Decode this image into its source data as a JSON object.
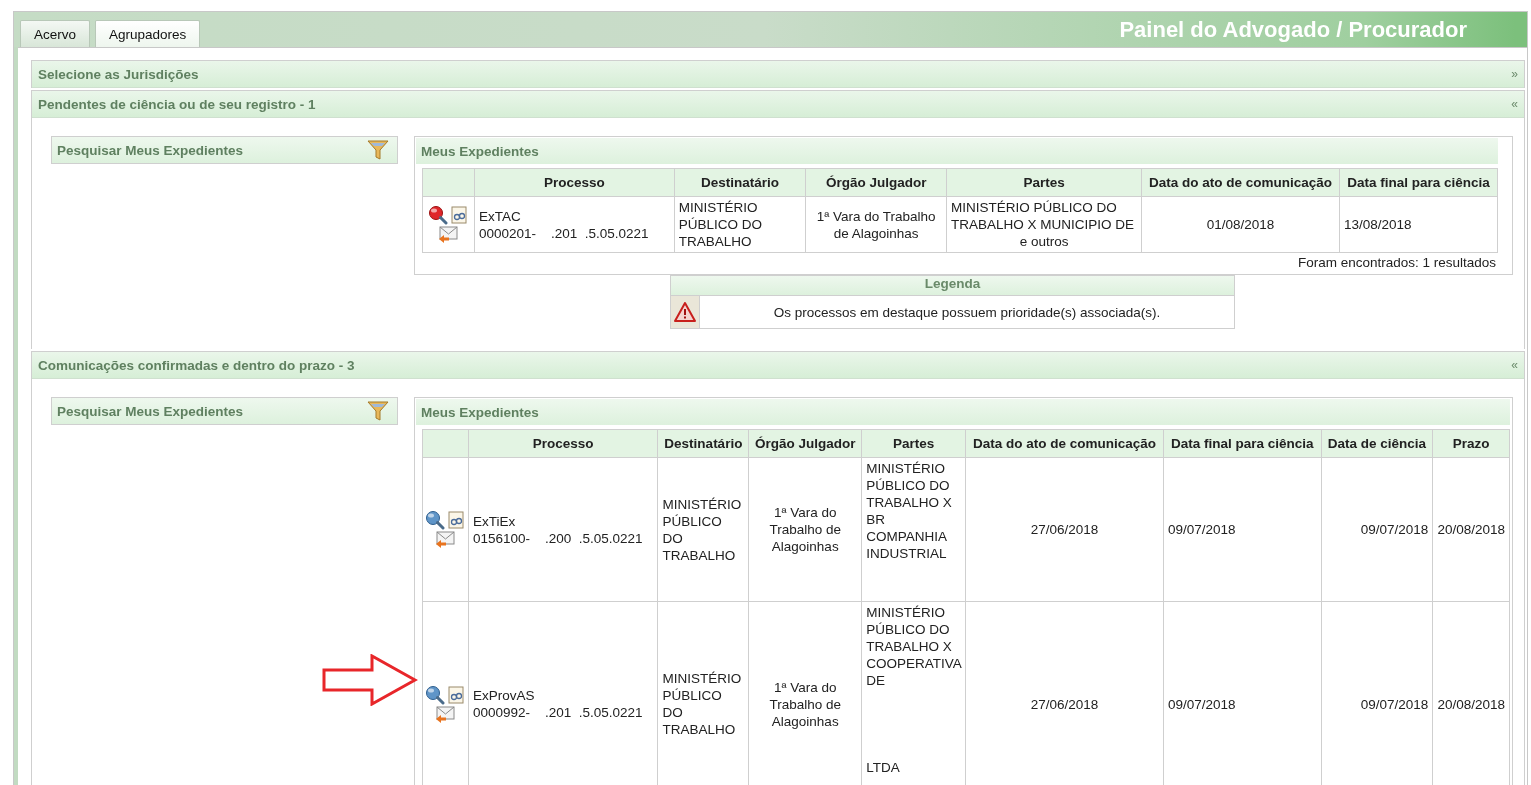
{
  "tabs": [
    {
      "label": "Acervo",
      "selected": false
    },
    {
      "label": "Agrupadores",
      "selected": true
    }
  ],
  "title": "Painel do Advogado / Procurador",
  "sections": [
    {
      "title": "Selecione as Jurisdições",
      "toggle": "»"
    },
    {
      "title": "Pendentes de ciência ou de seu registro - 1",
      "toggle": "«",
      "search_panel": {
        "title": "Pesquisar Meus Expedientes"
      },
      "results": {
        "title": "Meus Expedientes",
        "columns": [
          "Processo",
          "Destinatário",
          "Órgão Julgador",
          "Partes",
          "Data do ato de comunicação",
          "Data final para ciência"
        ],
        "rows": [
          {
            "priority": true,
            "class": "ExTAC",
            "number": "0000201-    .201  .5.05.0221",
            "destinatario": "MINISTÉRIO PÚBLICO DO TRABALHO",
            "orgao": "1ª Vara do Trabalho de Alagoinhas",
            "partes": [
              "MINISTÉRIO PÚBLICO DO TRABALHO X MUNICIPIO DE",
              "e outros"
            ],
            "dates": [
              "01/08/2018",
              "13/08/2018"
            ]
          }
        ],
        "footer": "Foram encontrados: 1 resultados"
      },
      "legend": {
        "title": "Legenda",
        "text": "Os processos em destaque possuem prioridade(s) associada(s)."
      }
    },
    {
      "title": "Comunicações confirmadas e dentro do prazo - 3",
      "toggle": "«",
      "search_panel": {
        "title": "Pesquisar Meus Expedientes"
      },
      "results": {
        "title": "Meus Expedientes",
        "columns": [
          "Processo",
          "Destinatário",
          "Órgão Julgador",
          "Partes",
          "Data do ato de comunicação",
          "Data final para ciência",
          "Data de ciência",
          "Prazo"
        ],
        "rows": [
          {
            "priority": false,
            "class": "ExTiEx",
            "number": "0156100-    .200  .5.05.0221",
            "destinatario": "MINISTÉRIO PÚBLICO DO TRABALHO",
            "orgao": "1ª Vara do Trabalho de Alagoinhas",
            "partes": [
              "MINISTÉRIO PÚBLICO DO TRABALHO X BR COMPANHIA INDUSTRIAL"
            ],
            "dates": [
              "27/06/2018",
              "09/07/2018",
              "09/07/2018",
              "20/08/2018"
            ]
          },
          {
            "priority": false,
            "class": "ExProvAS",
            "number": "0000992-    .201  .5.05.0221",
            "destinatario": "MINISTÉRIO PÚBLICO DO TRABALHO",
            "orgao": "1ª Vara do Trabalho de Alagoinhas",
            "partes": [
              "MINISTÉRIO PÚBLICO DO TRABALHO X COOPERATIVA DE",
              "LTDA"
            ],
            "dates": [
              "27/06/2018",
              "09/07/2018",
              "09/07/2018",
              "20/08/2018"
            ]
          }
        ]
      }
    }
  ],
  "annotation": {
    "kind": "arrow"
  }
}
